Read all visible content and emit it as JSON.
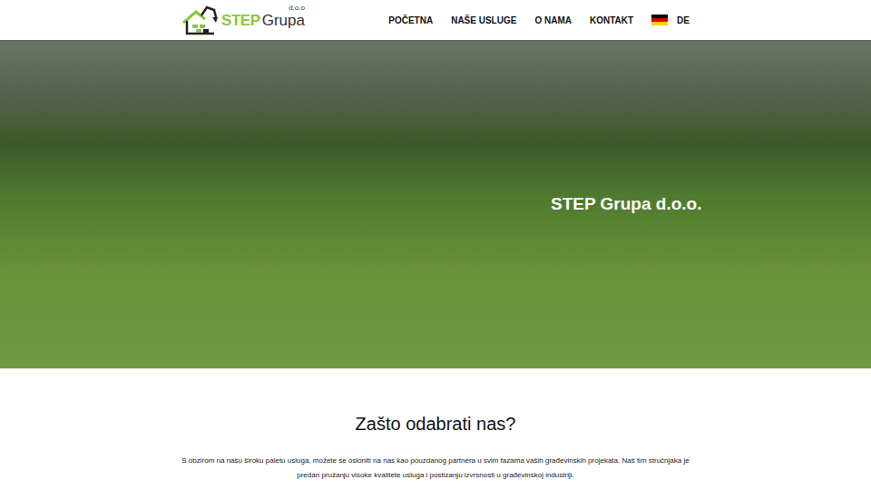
{
  "logo": {
    "brand": "STEP",
    "name": "Grupa",
    "suffix": "d.o.o"
  },
  "nav": [
    {
      "label": "POČETNA"
    },
    {
      "label": "NAŠE USLUGE"
    },
    {
      "label": "O NAMA"
    },
    {
      "label": "KONTAKT"
    }
  ],
  "language": {
    "label": "DE"
  },
  "hero": {
    "title": "STEP Grupa d.o.o."
  },
  "section": {
    "heading": "Zašto odabrati nas?",
    "text": "S obzirom na našu široku paletu usluga, možete se osloniti na nas kao pouzdanog partnera u svim fazama vaših građevinskih projekata. Naš tim stručnjaka je predan pružanju visoke kvalitete usluga i postizanju izvrsnosti u građevinskoj industriji."
  }
}
